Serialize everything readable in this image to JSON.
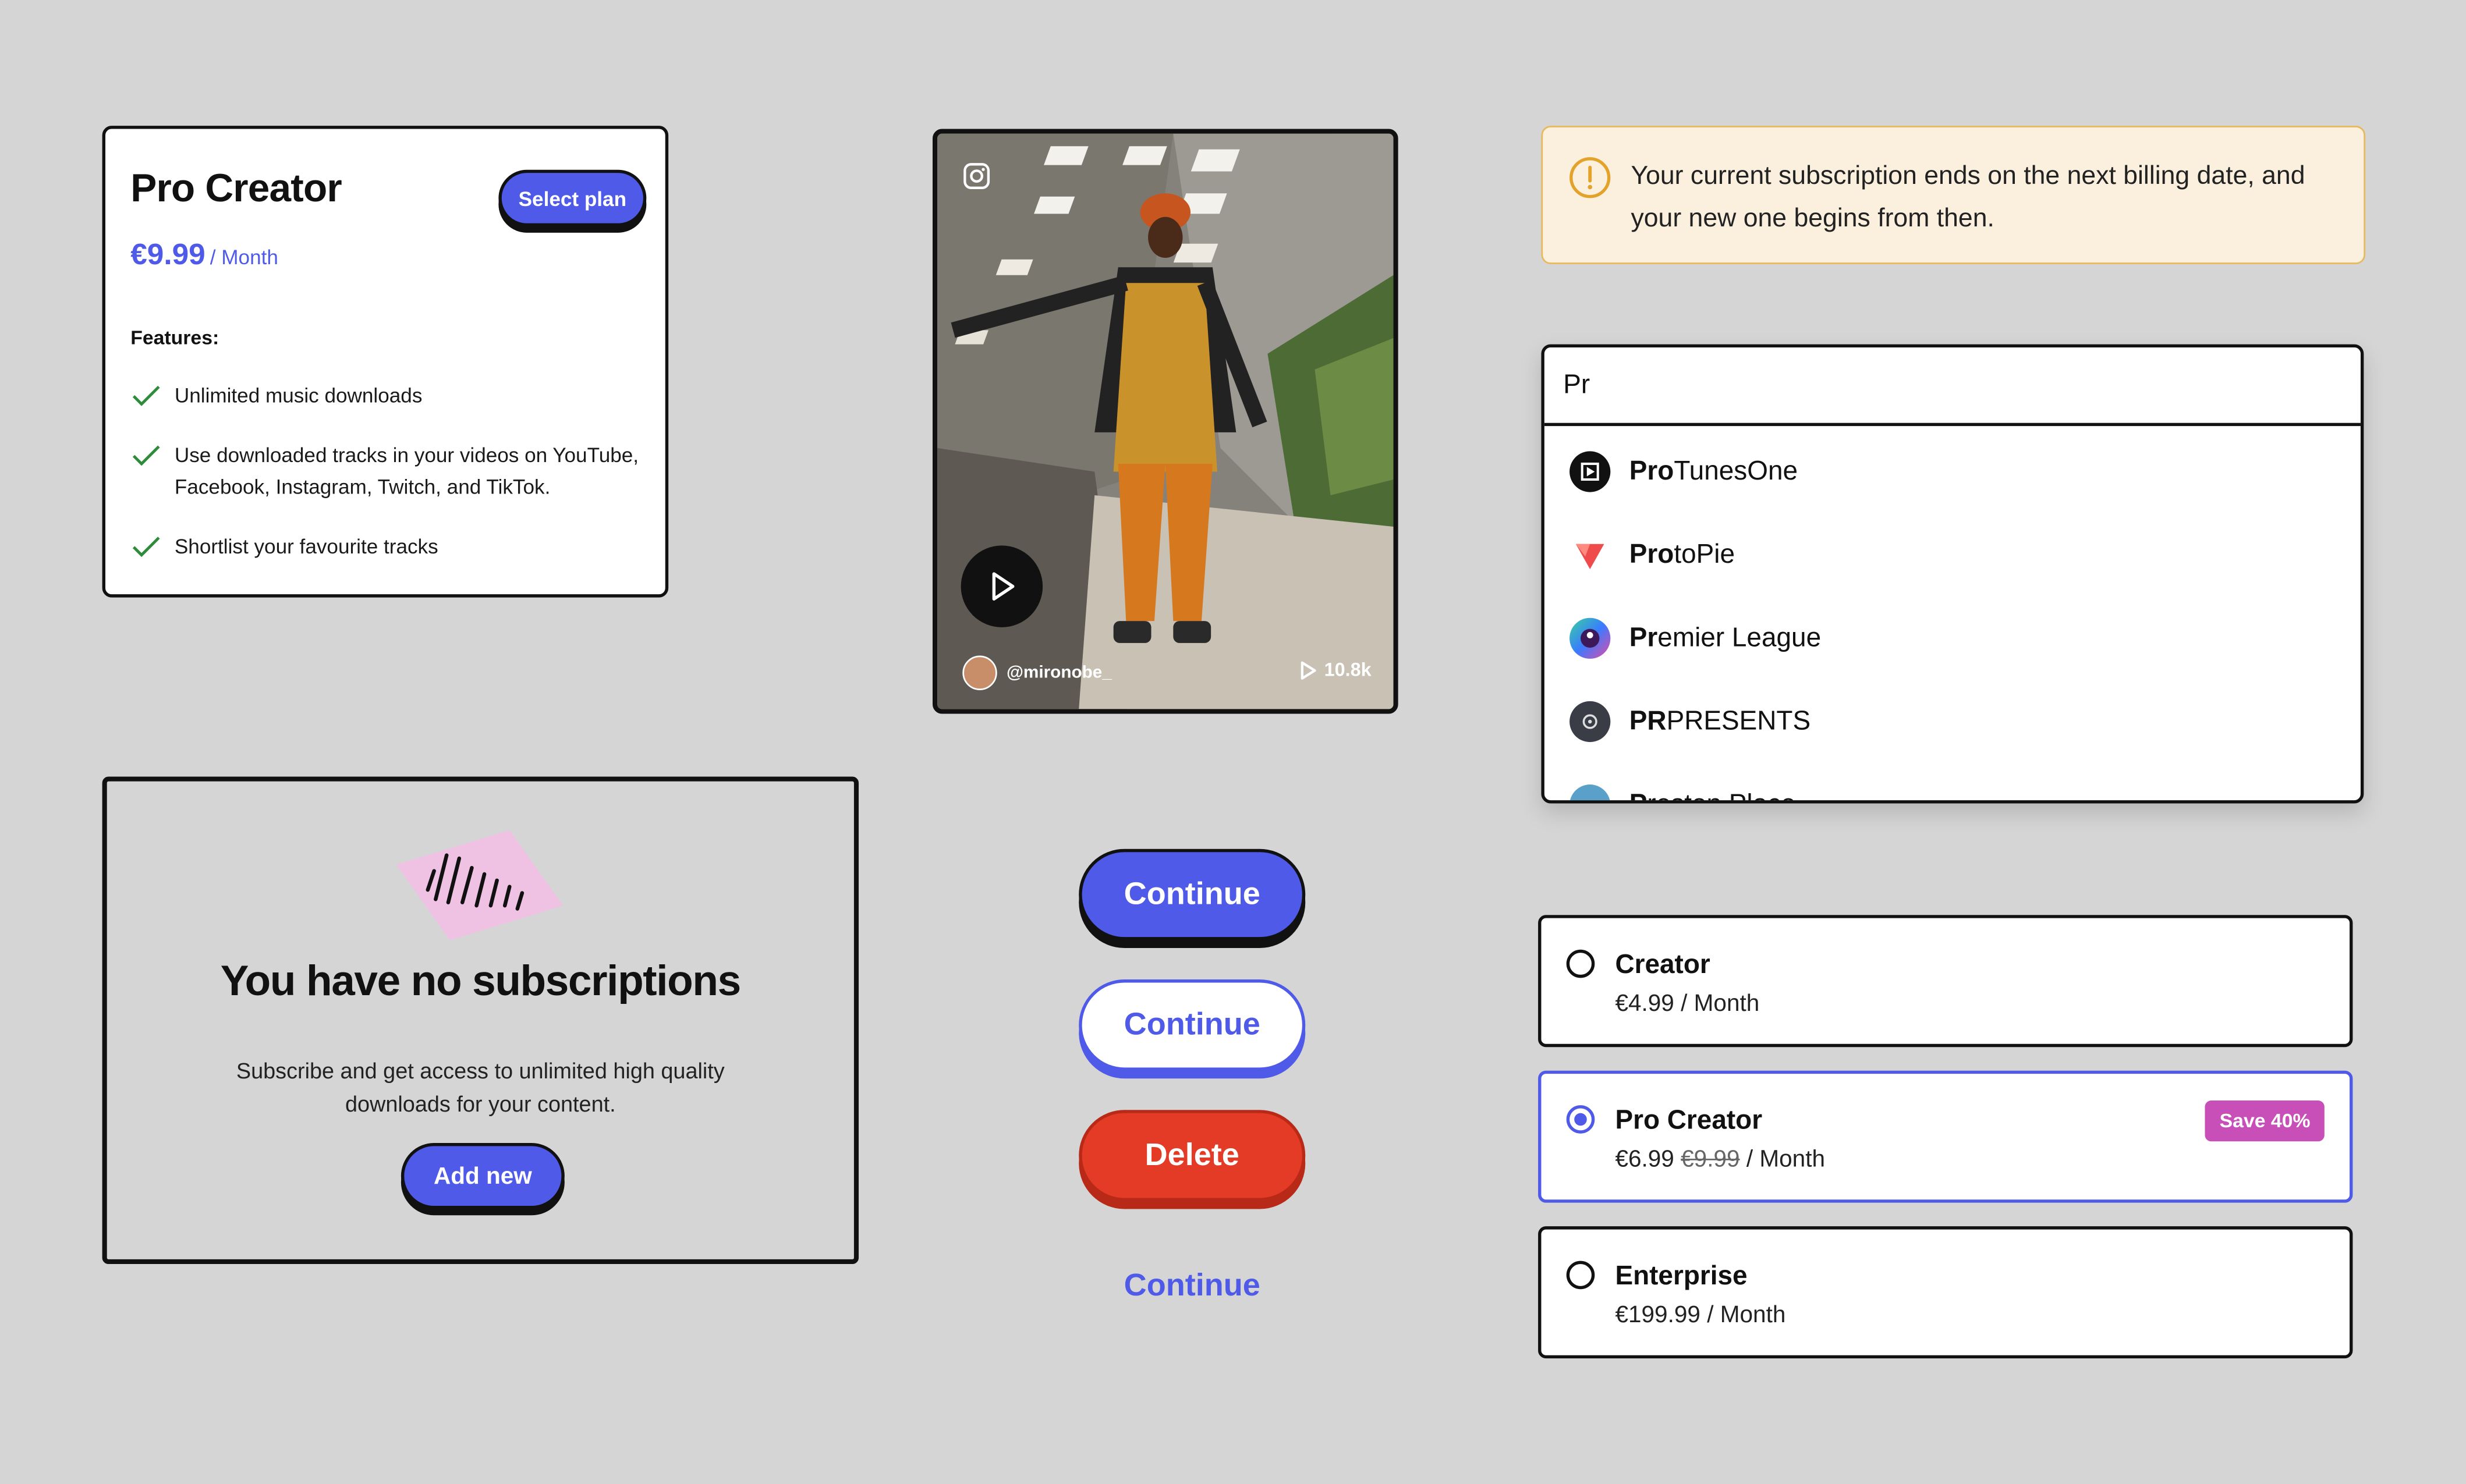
{
  "plan_card": {
    "title": "Pro Creator",
    "price": "€9.99",
    "period": "/ Month",
    "select_label": "Select plan",
    "features_label": "Features:",
    "features": [
      "Unlimited music downloads",
      "Use downloaded tracks in your videos on YouTube, Facebook, Instagram, Twitch, and TikTok.",
      "Shortlist your favourite tracks"
    ]
  },
  "video": {
    "username": "@mironobe_",
    "views": "10.8k"
  },
  "alert": {
    "text": "Your current subscription ends on the next billing date, and your new one begins from then."
  },
  "search": {
    "query": "Pr",
    "results": [
      {
        "match": "Pro",
        "rest": "TunesOne"
      },
      {
        "match": "Pro",
        "rest": "toPie"
      },
      {
        "match": "Pr",
        "rest": "emier League"
      },
      {
        "match": "PR",
        "rest": "PRESENTS"
      },
      {
        "match": "P",
        "rest": "reston Place"
      }
    ]
  },
  "empty_state": {
    "title": "You have no subscriptions",
    "text": "Subscribe and get access to unlimited high quality downloads for your content.",
    "button": "Add new"
  },
  "buttons": {
    "primary": "Continue",
    "secondary": "Continue",
    "danger": "Delete",
    "text": "Continue"
  },
  "plan_options": [
    {
      "name": "Creator",
      "price": "€4.99",
      "period": "/ Month",
      "old_price": "",
      "badge": "",
      "selected": false
    },
    {
      "name": "Pro Creator",
      "price": "€6.99",
      "old_price": "€9.99",
      "period": "/ Month",
      "badge": "Save 40%",
      "selected": true
    },
    {
      "name": "Enterprise",
      "price": "€199.99",
      "period": "/ Month",
      "old_price": "",
      "badge": "",
      "selected": false
    }
  ],
  "colors": {
    "accent": "#4f5be8",
    "danger": "#e33b26",
    "badge": "#c94fb8",
    "alert_bg": "#fbf0de",
    "alert_border": "#e7b95a",
    "background": "#d5d5d5"
  }
}
